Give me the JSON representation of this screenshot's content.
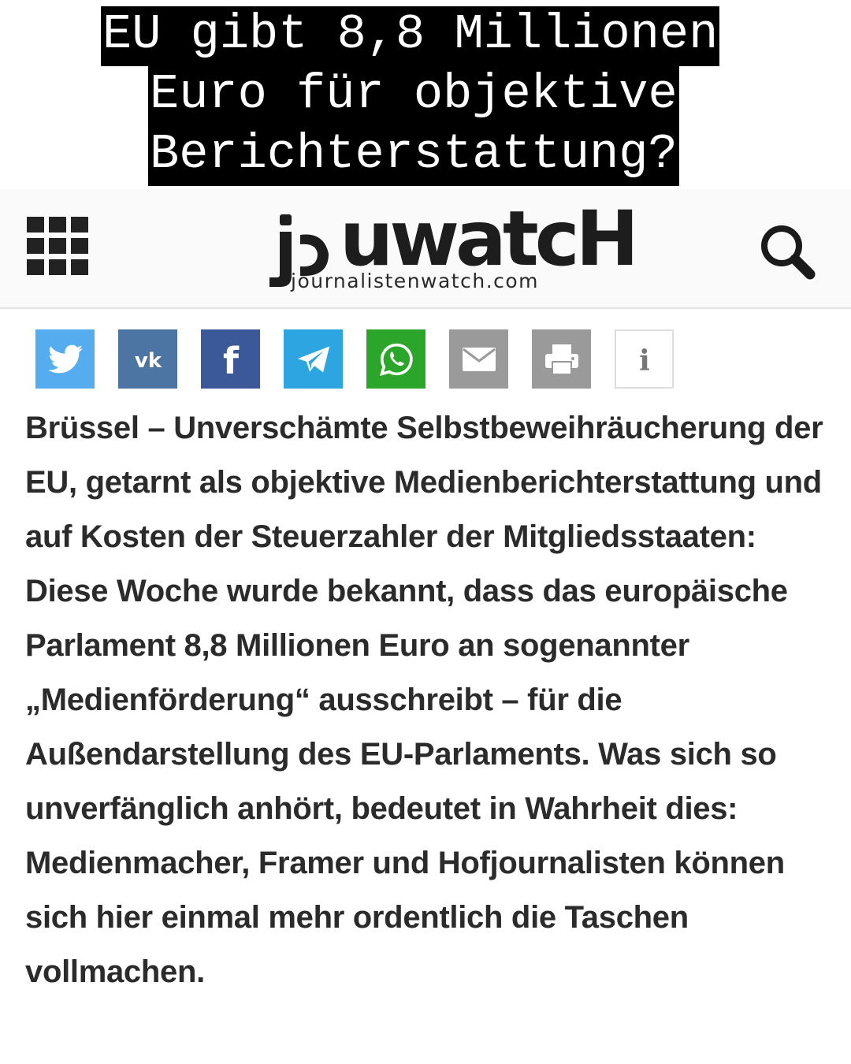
{
  "headline": {
    "line1": "EU gibt 8,8 Millionen",
    "line2": "Euro für objektive",
    "line3": "Berichterstattung?"
  },
  "header": {
    "logo_text": "jouwatch",
    "logo_subtitle": "journalistenwatch.com",
    "menu_icon": "grid-menu-icon",
    "search_icon": "search-icon"
  },
  "share_buttons": [
    {
      "name": "twitter",
      "icon": "twitter-icon",
      "color": "#55acee"
    },
    {
      "name": "vk",
      "icon": "vk-icon",
      "color": "#4c75a3"
    },
    {
      "name": "facebook",
      "icon": "facebook-icon",
      "color": "#3b5998"
    },
    {
      "name": "telegram",
      "icon": "telegram-icon",
      "color": "#2ca5e0"
    },
    {
      "name": "whatsapp",
      "icon": "whatsapp-icon",
      "color": "#2ba62b"
    },
    {
      "name": "email",
      "icon": "envelope-icon",
      "color": "#9a9a9a"
    },
    {
      "name": "print",
      "icon": "printer-icon",
      "color": "#9a9a9a"
    },
    {
      "name": "info",
      "icon": "info-icon",
      "color": "#ffffff"
    }
  ],
  "article": {
    "body": "Brüssel – Unverschämte Selbstbeweihräucherung der EU, getarnt als objektive Medienberichterstattung und auf Kosten der Steuerzahler der Mitgliedsstaaten: Diese Woche wurde bekannt, dass das europäische Parlament 8,8 Millionen Euro an sogenannter „Medienförderung“ ausschreibt – für die Außendarstellung des EU-Parlaments. Was sich so unverfänglich anhört, bedeutet in Wahrheit dies: Medienmacher, Framer und Hofjournalisten können sich hier einmal mehr ordentlich die Taschen vollmachen."
  }
}
